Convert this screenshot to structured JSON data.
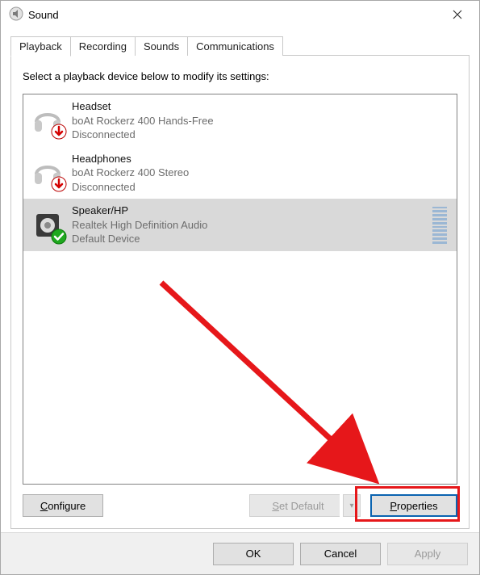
{
  "window": {
    "title": "Sound"
  },
  "tabs": [
    "Playback",
    "Recording",
    "Sounds",
    "Communications"
  ],
  "active_tab": 0,
  "instruction": "Select a playback device below to modify its settings:",
  "devices": [
    {
      "name": "Headset",
      "desc": "boAt Rockerz 400 Hands-Free",
      "status": "Disconnected",
      "state": "disconnected",
      "selected": false
    },
    {
      "name": "Headphones",
      "desc": "boAt Rockerz 400 Stereo",
      "status": "Disconnected",
      "state": "disconnected",
      "selected": false
    },
    {
      "name": "Speaker/HP",
      "desc": "Realtek High Definition Audio",
      "status": "Default Device",
      "state": "default",
      "selected": true
    }
  ],
  "buttons": {
    "configure": "Configure",
    "set_default": "Set Default",
    "properties": "Properties",
    "ok": "OK",
    "cancel": "Cancel",
    "apply": "Apply"
  },
  "icons": {
    "headset": "headset-icon",
    "speaker": "speaker-icon",
    "overlay_disconnected": "down-arrow-overlay",
    "overlay_default": "check-overlay"
  }
}
